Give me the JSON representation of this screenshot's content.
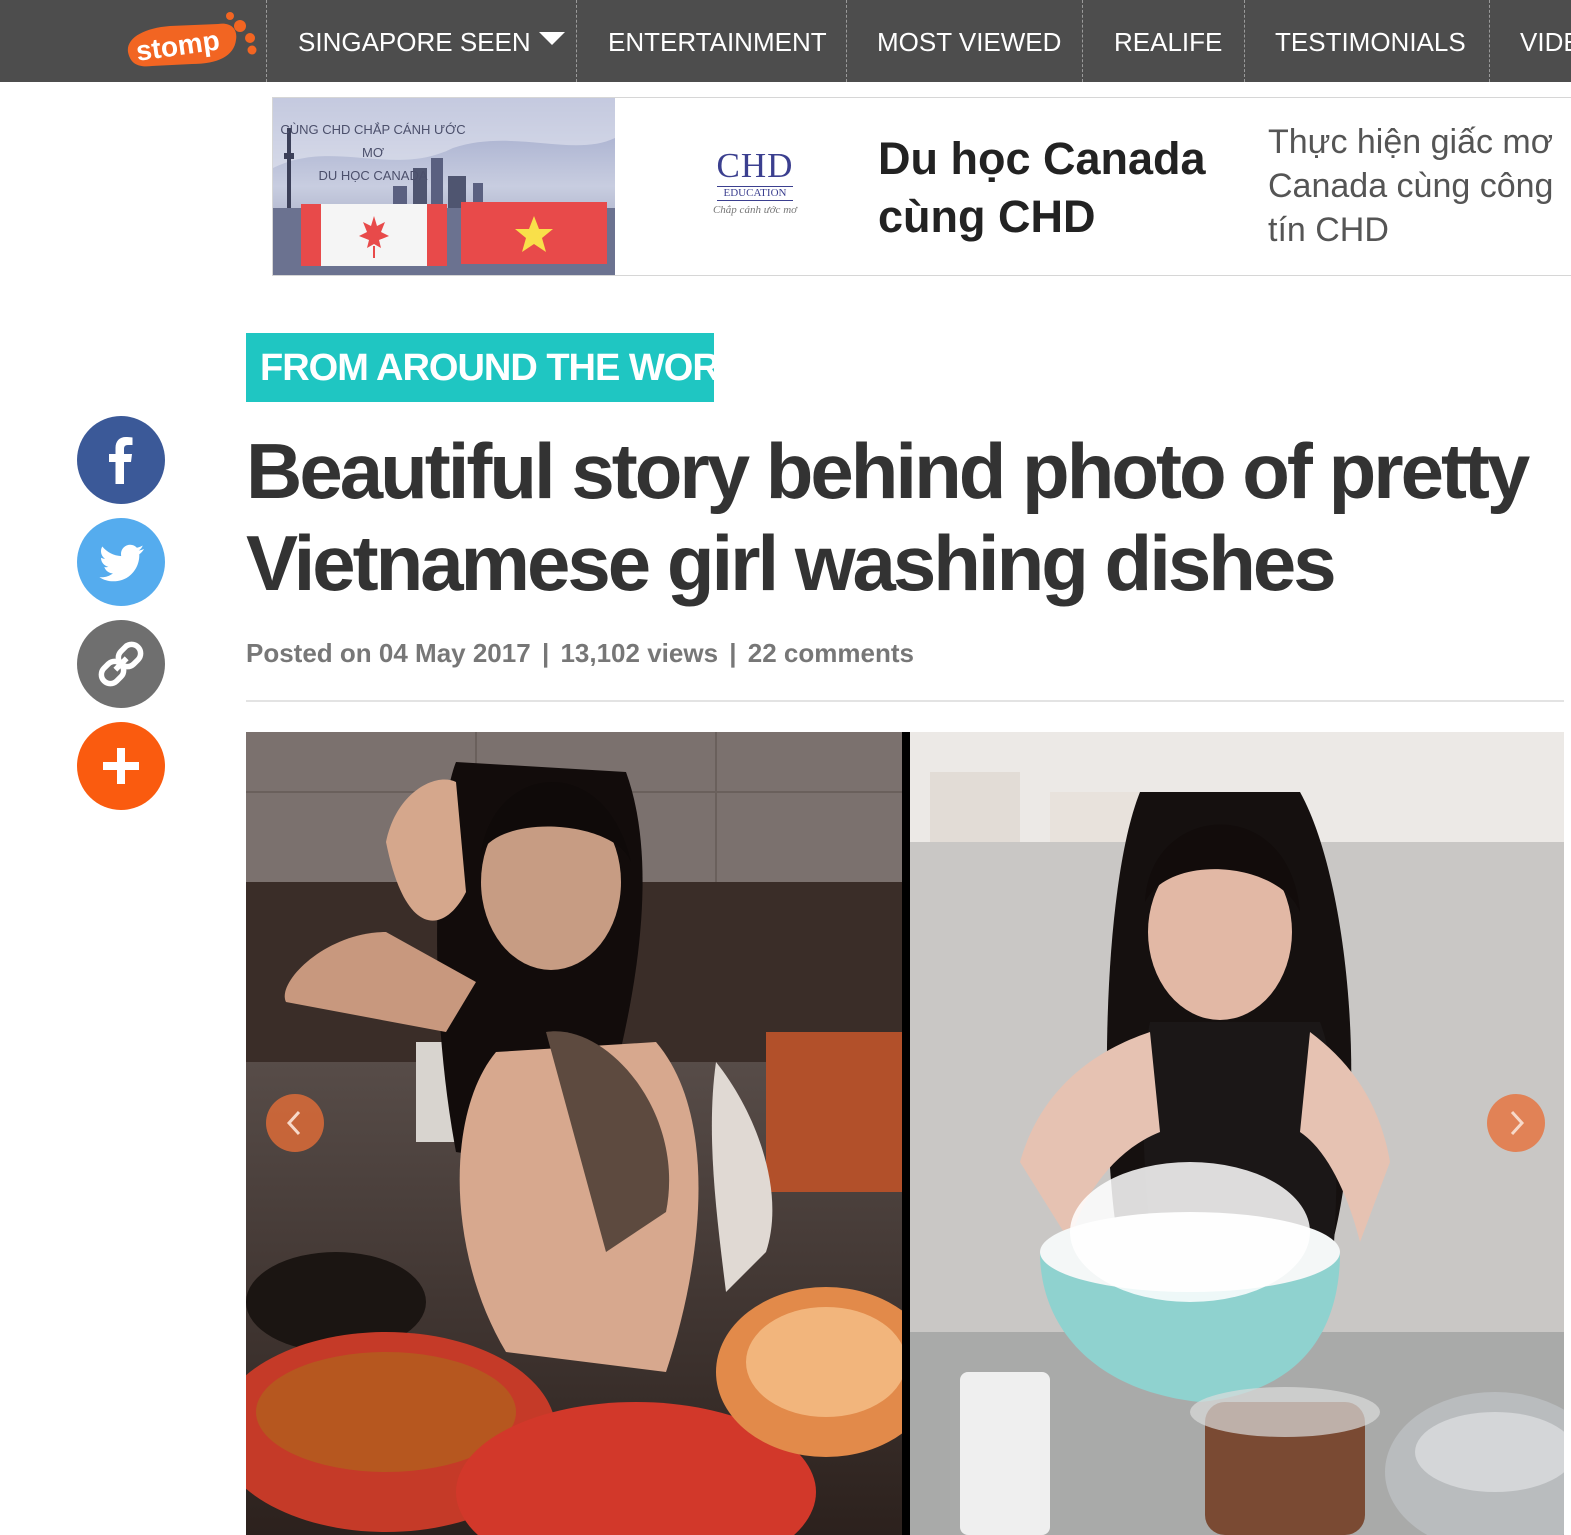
{
  "nav": {
    "logo": "stomp",
    "items": [
      {
        "label": "SINGAPORE SEEN",
        "icon": "caret-down-icon"
      },
      {
        "label": "ENTERTAINMENT"
      },
      {
        "label": "MOST VIEWED"
      },
      {
        "label": "REALIFE"
      },
      {
        "label": "TESTIMONIALS"
      },
      {
        "label": "VIDE"
      }
    ]
  },
  "ad": {
    "image_text_line1": "CÙNG CHD CHẮP CÁNH ƯỚC MƠ",
    "image_text_line2": "DU HỌC CANADA",
    "logo_brand": "CHD",
    "logo_sub": "EDUCATION",
    "logo_tagline": "Chắp cánh ước mơ",
    "headline": "Du học Canada cùng CHD",
    "description": "Thực hiện giấc mơ Canada cùng công tín CHD"
  },
  "article": {
    "category": "FROM AROUND THE WORLD",
    "title": "Beautiful story behind photo of pretty Vietnamese girl washing dishes",
    "posted_label": "Posted on",
    "date": "04 May 2017",
    "views": "13,102 views",
    "comments": "22 comments",
    "separator": "|"
  },
  "social": [
    "facebook-icon",
    "twitter-icon",
    "link-icon",
    "plus-icon"
  ],
  "colors": {
    "nav_bg": "#4d4d4d",
    "category_bg": "#1fc6c2",
    "facebook": "#3b5998",
    "twitter": "#55acee",
    "link": "#6f6f6f",
    "share": "#fa5b0f",
    "logo": "#f26522",
    "arrow": "#e86e37"
  }
}
